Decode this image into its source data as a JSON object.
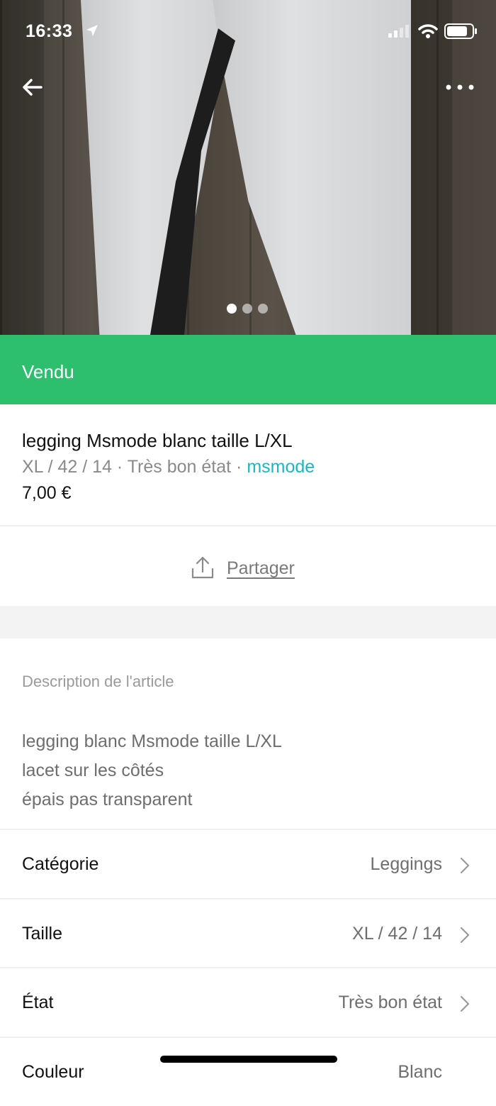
{
  "status_bar": {
    "time": "16:33"
  },
  "carousel": {
    "image_count": 3,
    "active_index": 0
  },
  "item": {
    "status": "Vendu",
    "title": "legging Msmode blanc taille L/XL",
    "size": "XL / 42 / 14",
    "separator": " · ",
    "condition": "Très bon état",
    "brand": "msmode",
    "price": "7,00 €"
  },
  "actions": {
    "share_label": "Partager"
  },
  "description": {
    "heading": "Description de l'article",
    "lines": [
      "legging blanc Msmode taille L/XL",
      "lacet sur les côtés",
      "épais pas transparent"
    ]
  },
  "attributes": [
    {
      "label": "Catégorie",
      "value": "Leggings"
    },
    {
      "label": "Taille",
      "value": "XL / 42 / 14"
    },
    {
      "label": "État",
      "value": "Très bon état"
    },
    {
      "label": "Couleur",
      "value": "Blanc"
    }
  ],
  "colors": {
    "sold_banner": "#2dbf6e",
    "brand_link": "#1db6bf"
  },
  "icons": [
    "location-arrow-icon",
    "signal-icon",
    "wifi-icon",
    "battery-icon",
    "back-arrow-icon",
    "more-dots-icon",
    "share-icon",
    "chevron-right-icon"
  ]
}
